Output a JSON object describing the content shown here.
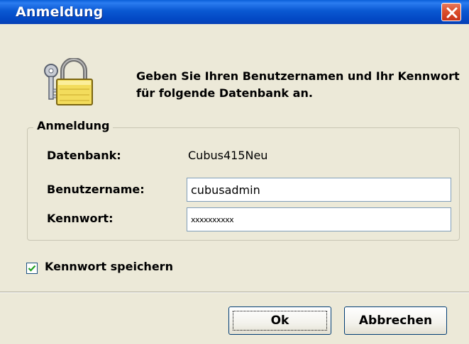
{
  "window": {
    "title": "Anmeldung"
  },
  "header": {
    "icon": "lock-keys-icon",
    "message": "Geben Sie Ihren Benutzernamen und Ihr Kennwort für folgende Datenbank an."
  },
  "group": {
    "legend": "Anmeldung",
    "database": {
      "label": "Datenbank:",
      "value": "Cubus415Neu"
    },
    "username": {
      "label": "Benutzername:",
      "value": "cubusadmin"
    },
    "password": {
      "label": "Kennwort:",
      "value": "xxxxxxxxxx"
    }
  },
  "save_password": {
    "label": "Kennwort speichern",
    "checked": true
  },
  "buttons": {
    "ok": "Ok",
    "cancel": "Abbrechen"
  },
  "colors": {
    "titlebar": "#0a58d2",
    "close": "#dc4f2c",
    "dialog_bg": "#ece9d8"
  }
}
